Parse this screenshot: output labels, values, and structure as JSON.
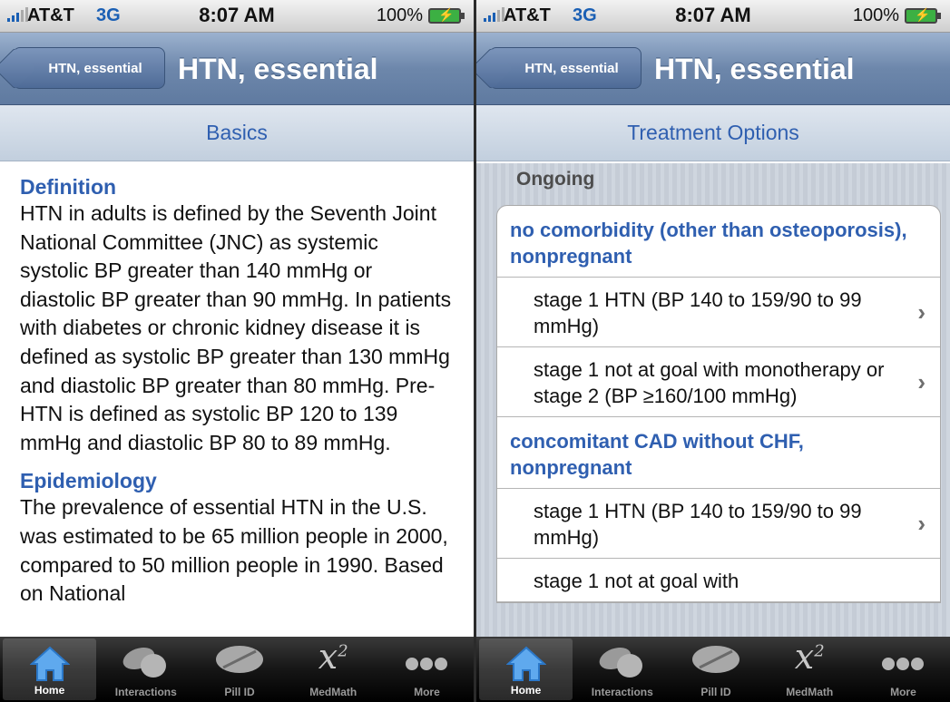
{
  "status_bar": {
    "carrier": "AT&T",
    "network": "3G",
    "time": "8:07 AM",
    "battery": "100%",
    "accent_color": "#1a5fb4"
  },
  "nav_bar": {
    "back_label": "HTN, essential",
    "title": "HTN, essential"
  },
  "left_screen": {
    "section_header": "Basics",
    "sections": [
      {
        "heading": "Definition",
        "body": "HTN in adults is defined by the Seventh Joint National Committee (JNC) as systemic systolic BP greater than 140 mmHg or diastolic BP greater than 90 mmHg. In patients with diabetes or chronic kidney disease it is defined as systolic BP greater than 130 mmHg and diastolic BP greater than 80 mmHg. Pre-HTN is defined as systolic BP 120 to 139 mmHg and diastolic BP 80 to 89 mmHg."
      },
      {
        "heading": "Epidemiology",
        "body": "The prevalence of essential HTN in the U.S. was estimated to be 65 million people in 2000, compared to 50 million people in 1990. Based on National"
      }
    ]
  },
  "right_screen": {
    "section_header": "Treatment Options",
    "group_label": "Ongoing",
    "rows": [
      {
        "type": "heading",
        "text": "no comorbidity (other than osteoporosis), nonpregnant"
      },
      {
        "type": "item",
        "text": "stage 1 HTN (BP 140 to 159/90 to 99 mmHg)"
      },
      {
        "type": "item",
        "text": "stage 1 not at goal with monotherapy or stage 2 (BP ≥160/100 mmHg)"
      },
      {
        "type": "heading",
        "text": "concomitant CAD without CHF, nonpregnant"
      },
      {
        "type": "item",
        "text": "stage 1 HTN (BP 140 to 159/90 to 99 mmHg)"
      },
      {
        "type": "item",
        "text": "stage 1 not at goal with"
      }
    ],
    "chevron": "›"
  },
  "tab_bar": {
    "tabs": [
      {
        "label": "Home",
        "icon": "home-icon",
        "active": true
      },
      {
        "label": "Interactions",
        "icon": "pills-icon",
        "active": false
      },
      {
        "label": "Pill ID",
        "icon": "pill-icon",
        "active": false
      },
      {
        "label": "MedMath",
        "icon": "math-icon",
        "active": false
      },
      {
        "label": "More",
        "icon": "more-dots-icon",
        "active": false
      }
    ],
    "math_glyph": "x",
    "math_sup": "2"
  }
}
